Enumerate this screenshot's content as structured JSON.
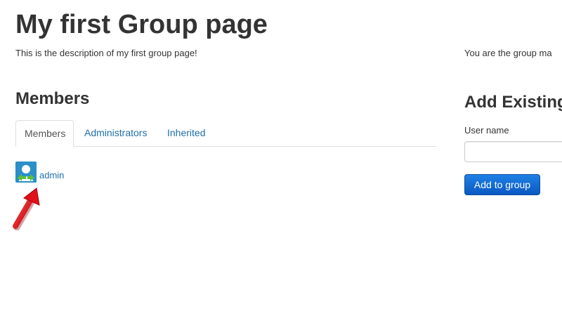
{
  "page": {
    "title": "My first Group page",
    "description": "This is the description of my first group page!"
  },
  "members": {
    "heading": "Members",
    "tabs": [
      {
        "label": "Members",
        "active": true
      },
      {
        "label": "Administrators",
        "active": false
      },
      {
        "label": "Inherited",
        "active": false
      }
    ],
    "list": [
      {
        "name": "admin",
        "avatar": "user-avatar-icon"
      }
    ]
  },
  "sidebar": {
    "manager_note": "You are the group ma",
    "add_heading": "Add Existing",
    "username_label": "User name",
    "username_value": "",
    "add_button_label": "Add to group"
  },
  "annotation": {
    "icon": "red-arrow-icon",
    "color": "#e0101a"
  },
  "colors": {
    "link": "#1e6fa8",
    "button": "#1468d4"
  }
}
